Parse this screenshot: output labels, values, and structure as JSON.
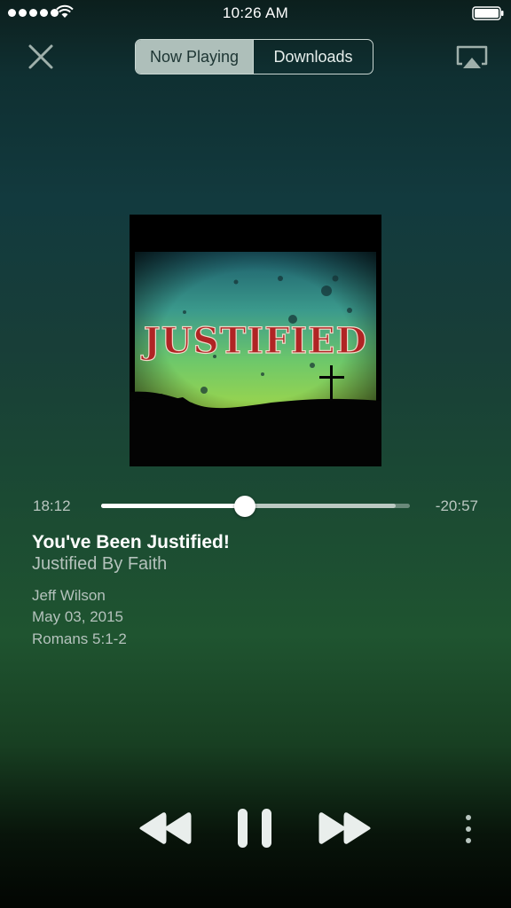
{
  "status_bar": {
    "time": "10:26 AM",
    "icons": [
      "signal-dots-icon",
      "wifi-icon",
      "battery-icon"
    ]
  },
  "header": {
    "close_icon": "close-icon",
    "tabs": [
      {
        "label": "Now Playing",
        "active": true
      },
      {
        "label": "Downloads",
        "active": false
      }
    ],
    "airplay_icon": "airplay-icon"
  },
  "artwork": {
    "text": "JUSTIFIED"
  },
  "progress": {
    "elapsed": "18:12",
    "remaining": "-20:57",
    "played_fraction": 0.465,
    "buffered_fraction": 0.955
  },
  "track": {
    "title": "You've Been Justified!",
    "series": "Justified By Faith",
    "speaker": "Jeff Wilson",
    "date": "May 03, 2015",
    "passage": "Romans 5:1-2"
  },
  "controls": {
    "icons": [
      "rewind-icon",
      "pause-icon",
      "fast-forward-icon",
      "more-icon"
    ]
  },
  "colors": {
    "accent": "#ffffff",
    "secondary_text": "#b4c2bc",
    "segment_active_bg": "#aebfba"
  }
}
